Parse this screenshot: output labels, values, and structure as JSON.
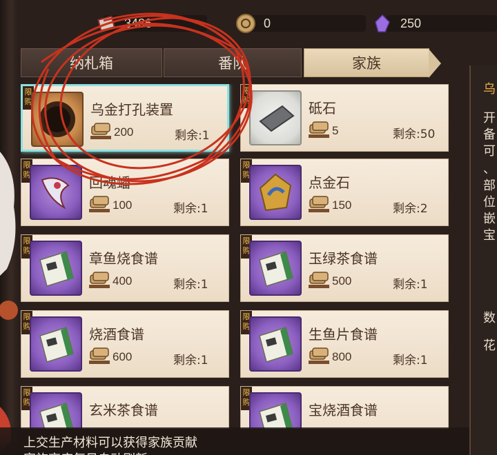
{
  "currencies": [
    {
      "icon": "ticket-icon",
      "value": "3486"
    },
    {
      "icon": "coin-icon",
      "value": "0"
    },
    {
      "icon": "crystal-icon",
      "value": "250"
    }
  ],
  "tabs": [
    {
      "label": "纳札箱",
      "active": false
    },
    {
      "label": "番队",
      "active": false
    },
    {
      "label": "家族",
      "active": true
    }
  ],
  "badge_text": "限购",
  "items": [
    {
      "name": "乌金打孔装置",
      "price": "200",
      "remain": "剩余:1",
      "icon": "drill-ring-icon",
      "icon_style": "bronze",
      "selected": true
    },
    {
      "name": "砥石",
      "price": "5",
      "remain": "剩余:50",
      "icon": "whetstone-icon",
      "icon_style": "grey",
      "selected": false
    },
    {
      "name": "回魂蟠",
      "price": "100",
      "remain": "剩余:1",
      "icon": "soul-banner-icon",
      "icon_style": "purple",
      "selected": false
    },
    {
      "name": "点金石",
      "price": "150",
      "remain": "剩余:2",
      "icon": "gold-stone-icon",
      "icon_style": "purple",
      "selected": false
    },
    {
      "name": "章鱼烧食谱",
      "price": "400",
      "remain": "剩余:1",
      "icon": "recipe-book-icon",
      "icon_style": "purple",
      "selected": false
    },
    {
      "name": "玉绿茶食谱",
      "price": "500",
      "remain": "剩余:1",
      "icon": "recipe-book-icon",
      "icon_style": "purple",
      "selected": false
    },
    {
      "name": "烧酒食谱",
      "price": "600",
      "remain": "剩余:1",
      "icon": "recipe-book-icon",
      "icon_style": "purple",
      "selected": false
    },
    {
      "name": "生鱼片食谱",
      "price": "800",
      "remain": "剩余:1",
      "icon": "recipe-book-icon",
      "icon_style": "purple",
      "selected": false
    },
    {
      "name": "玄米茶食谱",
      "price": "",
      "remain": "",
      "icon": "recipe-book-icon",
      "icon_style": "purple",
      "selected": false
    },
    {
      "name": "宝烧酒食谱",
      "price": "",
      "remain": "",
      "icon": "recipe-book-icon",
      "icon_style": "purple",
      "selected": false
    }
  ],
  "right_panel": {
    "title": "乌",
    "lines": [
      "开",
      "备",
      "可",
      "、",
      "部",
      "位",
      "嵌",
      "宝"
    ],
    "label1": "数",
    "label2": "花"
  },
  "footer": {
    "line1": "上交生产材料可以获得家族贡献",
    "line2": "家族商店每日自动刷新"
  },
  "colors": {
    "accent_selected": "#8be2e0",
    "scribble": "#c8321e",
    "tab_active": "#d7c29d"
  }
}
